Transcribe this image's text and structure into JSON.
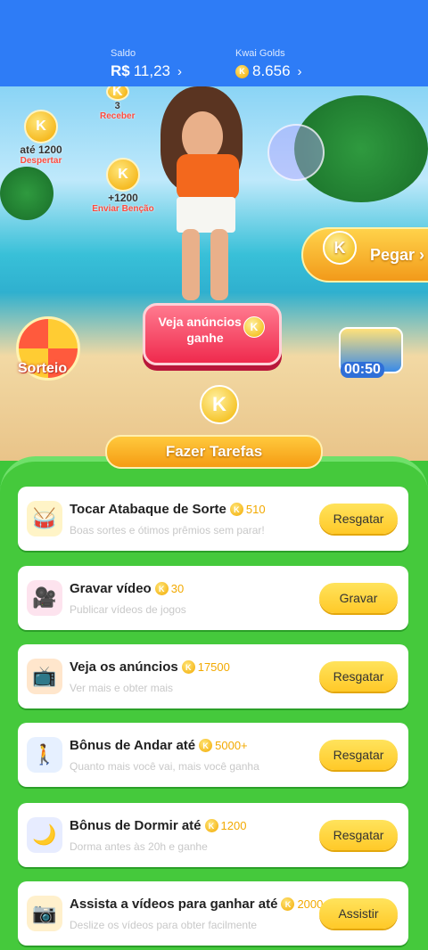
{
  "header": {
    "saldo_label": "Saldo",
    "saldo_currency": "R$",
    "saldo_value": "11,23",
    "golds_label": "Kwai Golds",
    "golds_value": "8.656",
    "chevron": "›"
  },
  "scene": {
    "receber_count": "3",
    "receber_label": "Receber",
    "despertar_amount": "até 1200",
    "despertar_label": "Despertar",
    "bencao_amount": "+1200",
    "bencao_label": "Enviar Benção",
    "pegar_label": "Pegar ›",
    "ads_button_label": "Veja anúncios e ganhe",
    "sorteio_label": "Sorteio",
    "timer": "00:50",
    "coin_letter": "K"
  },
  "banner": {
    "title": "Fazer Tarefas"
  },
  "tasks": [
    {
      "title": "Tocar Atabaque de Sorte",
      "reward": "510",
      "subtitle": "Boas sortes e ótimos prêmios sem parar!",
      "button": "Resgatar",
      "icon": "drum-icon"
    },
    {
      "title": "Gravar vídeo",
      "reward": "30",
      "subtitle": "Publicar vídeos de jogos",
      "button": "Gravar",
      "icon": "video-camera-icon"
    },
    {
      "title": "Veja os anúncios",
      "reward": "17500",
      "subtitle": "Ver mais e obter mais",
      "button": "Resgatar",
      "icon": "tv-icon"
    },
    {
      "title": "Bônus de Andar até",
      "reward": "5000+",
      "subtitle": "Quanto mais você vai, mais você ganha",
      "button": "Resgatar",
      "icon": "walking-person-icon"
    },
    {
      "title": "Bônus de Dormir até",
      "reward": "1200",
      "subtitle": "Dorma antes às 20h e ganhe",
      "button": "Resgatar",
      "icon": "sleep-icon"
    },
    {
      "title": "Assista a vídeos para ganhar até",
      "reward": "2000",
      "subtitle": "Deslize os vídeos para obter facilmente",
      "button": "Assistir",
      "icon": "camera-icon"
    }
  ]
}
